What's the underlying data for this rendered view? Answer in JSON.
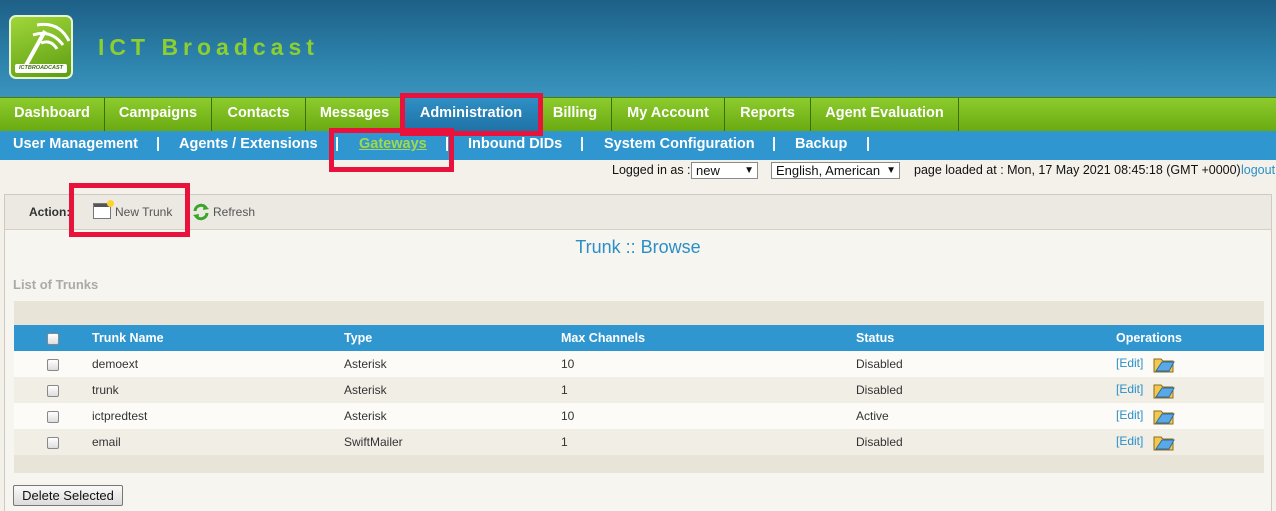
{
  "app": {
    "brand": "ICT Broadcast",
    "logo_text": "ICTBROADCAST"
  },
  "main_nav": [
    {
      "label": "Dashboard"
    },
    {
      "label": "Campaigns"
    },
    {
      "label": "Contacts"
    },
    {
      "label": "Messages"
    },
    {
      "label": "Administration",
      "active": true
    },
    {
      "label": "Billing"
    },
    {
      "label": "My Account"
    },
    {
      "label": "Reports"
    },
    {
      "label": "Agent Evaluation"
    }
  ],
  "sub_nav": [
    {
      "label": "User Management"
    },
    {
      "label": "Agents / Extensions"
    },
    {
      "label": "Gateways",
      "active": true
    },
    {
      "label": "Inbound DIDs"
    },
    {
      "label": "System Configuration"
    },
    {
      "label": "Backup"
    }
  ],
  "sub_nav_separator": "|",
  "infobar": {
    "logged_in_label": "Logged in as :",
    "user": "new",
    "language": "English, American",
    "page_loaded": "page loaded at : Mon, 17 May 2021 08:45:18 (GMT +0000)",
    "logout": "logout"
  },
  "actions": {
    "label": "Action:",
    "new_trunk": "New Trunk",
    "refresh": "Refresh"
  },
  "page_title": "Trunk :: Browse",
  "list_title": "List of Trunks",
  "table": {
    "columns": [
      "Trunk Name",
      "Type",
      "Max Channels",
      "Status",
      "Operations"
    ],
    "rows": [
      {
        "name": "demoext",
        "type": "Asterisk",
        "max_channels": "10",
        "status": "Disabled",
        "edit": "[Edit]"
      },
      {
        "name": "trunk",
        "type": "Asterisk",
        "max_channels": "1",
        "status": "Disabled",
        "edit": "[Edit]"
      },
      {
        "name": "ictpredtest",
        "type": "Asterisk",
        "max_channels": "10",
        "status": "Active",
        "edit": "[Edit]"
      },
      {
        "name": "email",
        "type": "SwiftMailer",
        "max_channels": "1",
        "status": "Disabled",
        "edit": "[Edit]"
      }
    ]
  },
  "delete_selected": "Delete Selected",
  "colors": {
    "highlight": "#e8123c",
    "nav_green": "#7cbd1e",
    "nav_blue": "#2f96cf"
  }
}
